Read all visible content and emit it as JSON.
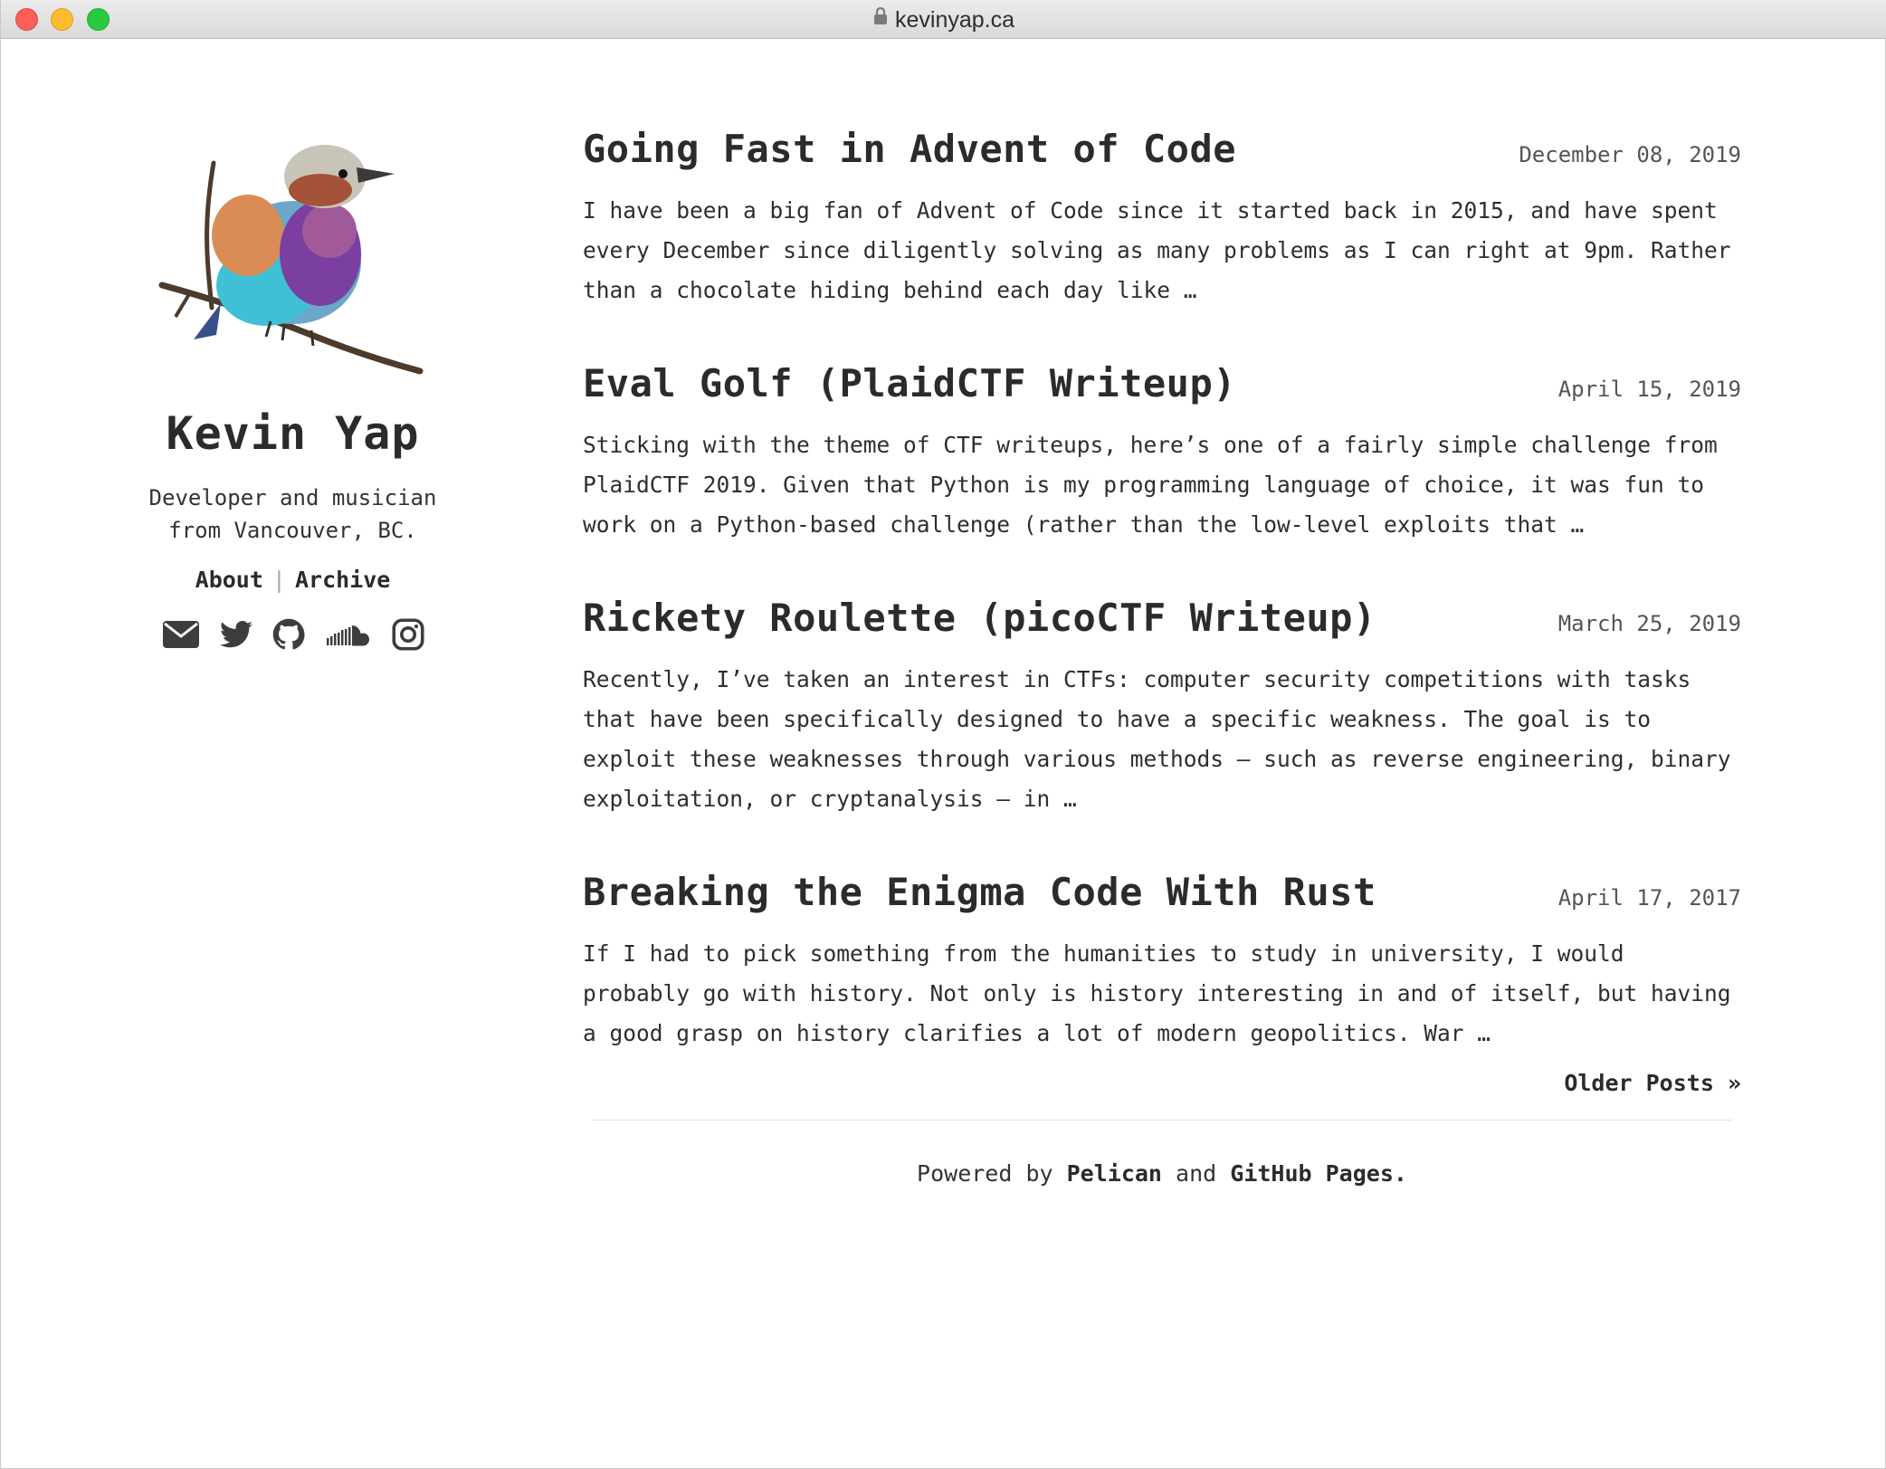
{
  "browser": {
    "url": "kevinyap.ca"
  },
  "sidebar": {
    "name": "Kevin Yap",
    "tagline_line1": "Developer and musician",
    "tagline_line2": "from Vancouver, BC.",
    "nav": [
      {
        "label": "About"
      },
      {
        "label": "Archive"
      }
    ],
    "separator": "|",
    "social_icons": [
      "email-icon",
      "twitter-icon",
      "github-icon",
      "soundcloud-icon",
      "instagram-icon"
    ]
  },
  "posts": [
    {
      "title": "Going Fast in Advent of Code",
      "date": "December 08, 2019",
      "summary": "I have been a big fan of Advent of Code since it started back in 2015, and have spent every December since diligently solving as many problems as I can right at 9pm. Rather than a chocolate hiding behind each day like …"
    },
    {
      "title": "Eval Golf (PlaidCTF Writeup)",
      "date": "April 15, 2019",
      "summary": "Sticking with the theme of CTF writeups, here’s one of a fairly simple challenge from PlaidCTF 2019. Given that Python is my programming language of choice, it was fun to work on a Python-based challenge (rather than the low-level exploits that …"
    },
    {
      "title": "Rickety Roulette (picoCTF Writeup)",
      "date": "March 25, 2019",
      "summary": "Recently, I’ve taken an interest in CTFs: computer security competitions with tasks that have been specifically designed to have a specific weakness. The goal is to exploit these weaknesses through various methods — such as reverse engineering, binary exploitation, or cryptanalysis — in …"
    },
    {
      "title": "Breaking the Enigma Code With Rust",
      "date": "April 17, 2017",
      "summary": "If I had to pick something from the humanities to study in university, I would probably go with history. Not only is history interesting in and of itself, but having a good grasp on history clarifies a lot of modern geopolitics. War …"
    }
  ],
  "pagination": {
    "older_label": "Older Posts »"
  },
  "footer": {
    "prefix": "Powered by",
    "link1": "Pelican",
    "middle": "and",
    "link2": "GitHub Pages",
    "suffix": "."
  },
  "colors": {
    "text": "#333333",
    "heading": "#2b2b2b",
    "close": "#fc5f57",
    "minimize": "#fdbc2e",
    "maximize": "#29c940"
  }
}
